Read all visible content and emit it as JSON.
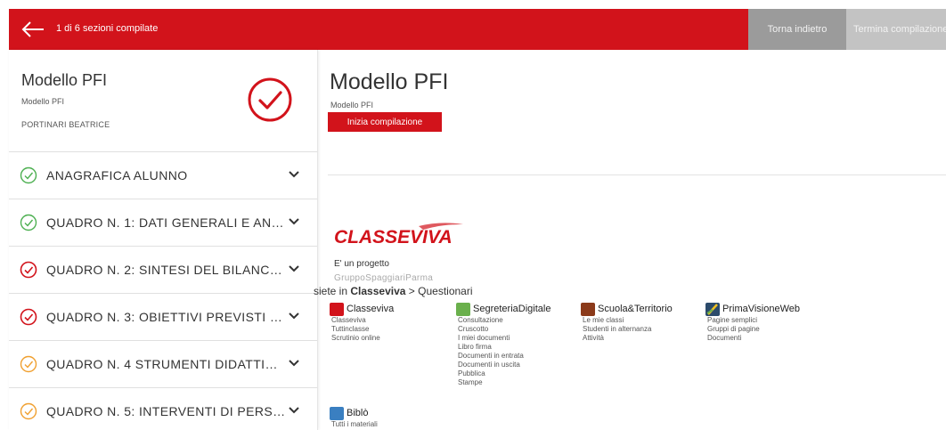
{
  "topbar": {
    "progress": "1 di 6  sezioni compilate",
    "back_button": "Torna indietro",
    "finish_button": "Termina compilazione"
  },
  "sidebar": {
    "title": "Modello PFI",
    "subtitle": "Modello PFI",
    "student": "PORTINARI BEATRICE",
    "sections": [
      {
        "label": "ANAGRAFICA ALUNNO",
        "status": "complete",
        "color": "#4caf50"
      },
      {
        "label": "QUADRO N. 1: DATI GENERALI E AN…",
        "status": "complete",
        "color": "#4caf50"
      },
      {
        "label": "QUADRO N. 2: SINTESI DEL BILANC…",
        "status": "error",
        "color": "#d2131b"
      },
      {
        "label": "QUADRO N. 3: OBIETTIVI PREVISTI …",
        "status": "error",
        "color": "#d2131b"
      },
      {
        "label": "QUADRO N. 4 STRUMENTI DIDATTI…",
        "status": "partial",
        "color": "#f0a030"
      },
      {
        "label": "QUADRO N. 5: INTERVENTI DI PERS…",
        "status": "partial",
        "color": "#f0a030"
      }
    ]
  },
  "main": {
    "title": "Modello PFI",
    "subtitle": "Modello PFI",
    "start_button": "Inizia compilazione"
  },
  "footer": {
    "logo_text": "CLASSEVIVA",
    "project_text": "E' un progetto",
    "company_text": "GruppoSpaggiariParma",
    "breadcrumb_prefix": "siete in",
    "breadcrumb_app": "Classeviva",
    "breadcrumb_sep": ">",
    "breadcrumb_page": "Questionari",
    "apps": [
      {
        "name": "Classeviva",
        "icon": "classeviva-icon",
        "color": "#d2131b",
        "links": [
          "Classeviva",
          "Tuttinclasse",
          "Scrutinio online"
        ]
      },
      {
        "name": "SegreteriaDigitale",
        "icon": "segreteria-digitale-icon",
        "color": "#6ab04c",
        "links": [
          "Consultazione",
          "Cruscotto",
          "I miei documenti",
          "Libro firma",
          "Documenti in entrata",
          "Documenti in uscita",
          "Pubblica",
          "Stampe"
        ]
      },
      {
        "name": "Scuola&Territorio",
        "icon": "scuola-territorio-icon",
        "color": "#8b3a1a",
        "links": [
          "Le mie classi",
          "Studenti in alternanza",
          "Attività"
        ]
      },
      {
        "name": "PrimaVisioneWeb",
        "icon": "prima-visione-web-icon",
        "color": "#2b4a6b",
        "links": [
          "Pagine semplici",
          "Gruppi di pagine",
          "Documenti"
        ]
      },
      {
        "name": "Biblò",
        "icon": "biblo-icon",
        "color": "#3a7fc1",
        "links": [
          "Tutti i materiali"
        ]
      }
    ]
  }
}
